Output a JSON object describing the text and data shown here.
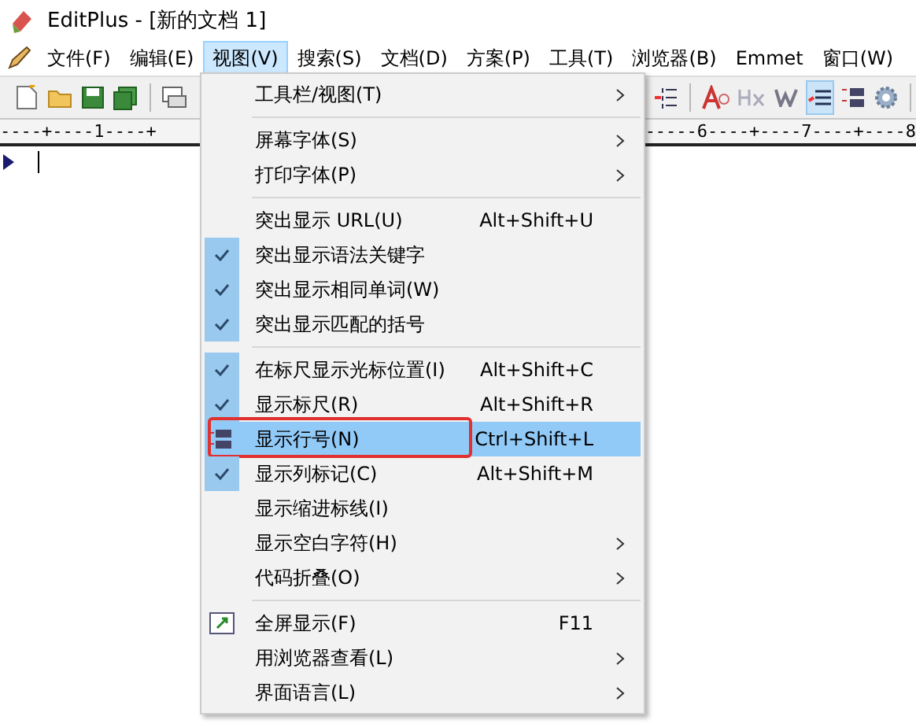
{
  "window": {
    "title": "EditPlus - [新的文档 1]"
  },
  "menubar": [
    {
      "label": "文件(F)",
      "selected": false
    },
    {
      "label": "编辑(E)",
      "selected": false
    },
    {
      "label": "视图(V)",
      "selected": true
    },
    {
      "label": "搜索(S)",
      "selected": false
    },
    {
      "label": "文档(D)",
      "selected": false
    },
    {
      "label": "方案(P)",
      "selected": false
    },
    {
      "label": "工具(T)",
      "selected": false
    },
    {
      "label": "浏览器(B)",
      "selected": false
    },
    {
      "label": "Emmet",
      "selected": false
    },
    {
      "label": "窗口(W)",
      "selected": false
    }
  ],
  "toolbar": [
    {
      "kind": "new",
      "pressed": false
    },
    {
      "kind": "open",
      "pressed": false
    },
    {
      "kind": "save",
      "pressed": false
    },
    {
      "kind": "save-all",
      "pressed": false
    },
    {
      "kind": "separator"
    },
    {
      "kind": "window",
      "pressed": false
    },
    {
      "kind": "gap"
    },
    {
      "kind": "numbering",
      "pressed": false
    },
    {
      "kind": "separator"
    },
    {
      "kind": "font",
      "pressed": false
    },
    {
      "kind": "hex",
      "pressed": false
    },
    {
      "kind": "wrap",
      "pressed": false
    },
    {
      "kind": "ruler-lines",
      "pressed": true
    },
    {
      "kind": "abcd",
      "pressed": false
    },
    {
      "kind": "gear",
      "pressed": false
    },
    {
      "kind": "separator"
    }
  ],
  "ruler": {
    "left": "----+----1----+",
    "right": "-----6----+----7----+----8"
  },
  "menu": [
    {
      "kind": "item",
      "label": "工具栏/视图(T)",
      "submenu": true,
      "checked": false,
      "selected": false
    },
    {
      "kind": "separator"
    },
    {
      "kind": "item",
      "label": "屏幕字体(S)",
      "submenu": true,
      "checked": false,
      "selected": false
    },
    {
      "kind": "item",
      "label": "打印字体(P)",
      "submenu": true,
      "checked": false,
      "selected": false
    },
    {
      "kind": "separator"
    },
    {
      "kind": "item",
      "label": "突出显示 URL(U)",
      "shortcut": "Alt+Shift+U",
      "submenu": false,
      "checked": false,
      "selected": false
    },
    {
      "kind": "item",
      "label": "突出显示语法关键字",
      "submenu": false,
      "checked": true,
      "selected": false
    },
    {
      "kind": "item",
      "label": "突出显示相同单词(W)",
      "submenu": false,
      "checked": true,
      "selected": false
    },
    {
      "kind": "item",
      "label": "突出显示匹配的括号",
      "submenu": false,
      "checked": true,
      "selected": false
    },
    {
      "kind": "separator"
    },
    {
      "kind": "item",
      "label": "在标尺显示光标位置(I)",
      "shortcut": "Alt+Shift+C",
      "submenu": false,
      "checked": true,
      "selected": false
    },
    {
      "kind": "item",
      "label": "显示标尺(R)",
      "shortcut": "Alt+Shift+R",
      "submenu": false,
      "checked": true,
      "selected": false
    },
    {
      "kind": "line-numbers-item",
      "label": "显示行号(N)",
      "shortcut": "Ctrl+Shift+L",
      "submenu": false,
      "checked": false,
      "selected": true,
      "annotated": true
    },
    {
      "kind": "item",
      "label": "显示列标记(C)",
      "shortcut": "Alt+Shift+M",
      "submenu": false,
      "checked": true,
      "selected": false
    },
    {
      "kind": "item",
      "label": "显示缩进标线(I)",
      "submenu": false,
      "checked": false,
      "selected": false
    },
    {
      "kind": "item",
      "label": "显示空白字符(H)",
      "submenu": true,
      "checked": false,
      "selected": false
    },
    {
      "kind": "item",
      "label": "代码折叠(O)",
      "submenu": true,
      "checked": false,
      "selected": false
    },
    {
      "kind": "separator"
    },
    {
      "kind": "fullscreen-item",
      "label": "全屏显示(F)",
      "shortcut": "F11",
      "submenu": false,
      "checked": false,
      "selected": false
    },
    {
      "kind": "item",
      "label": "用浏览器查看(L)",
      "submenu": true,
      "checked": false,
      "selected": false
    },
    {
      "kind": "item",
      "label": "界面语言(L)",
      "submenu": true,
      "checked": false,
      "selected": false
    }
  ]
}
